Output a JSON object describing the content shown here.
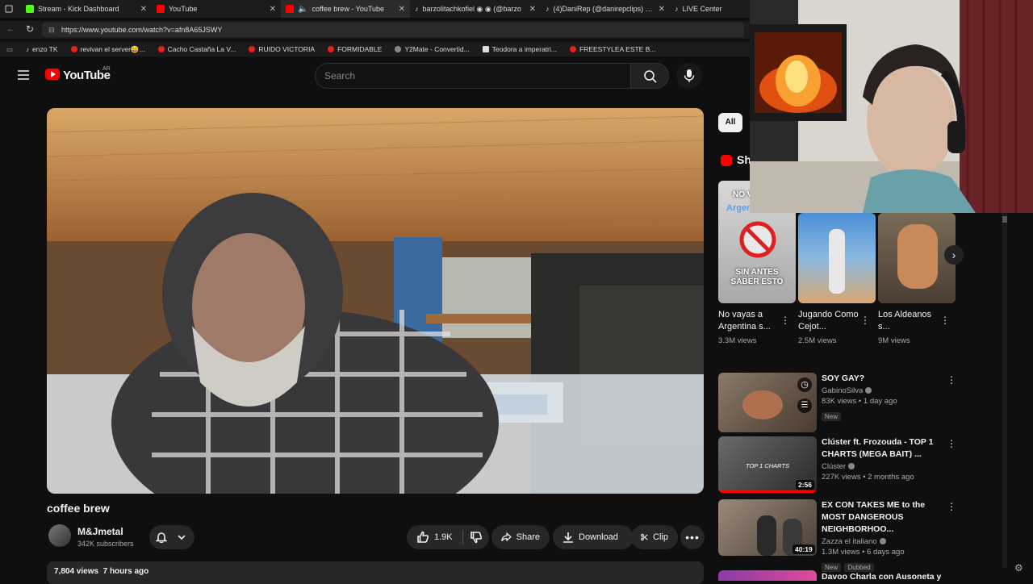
{
  "browser": {
    "tabs": [
      {
        "label": "Stream - Kick Dashboard",
        "color": "#53fc18"
      },
      {
        "label": "YouTube",
        "color": "#ff0000"
      },
      {
        "label": "coffee brew - YouTube",
        "color": "#ff0000"
      },
      {
        "label": "barzolitachkofiel ◉ ◉ (@barzo",
        "color": "#222"
      },
      {
        "label": "(4)DaniRep (@danirepclips) | TikT",
        "color": "#222"
      },
      {
        "label": "LIVE Center",
        "color": "#222"
      }
    ],
    "url": "https://www.youtube.com/watch?v=afn8A65JSWY",
    "bookmarks": [
      "enzo TK",
      "revivan el server😄...",
      "Cacho Castaña La V...",
      "RUIDO VICTORIA",
      "FORMIDABLE",
      "Y2Mate - Convertid...",
      "Teodora a imperatri...",
      "FREESTYLEA ESTE B..."
    ]
  },
  "header": {
    "logo_text": "YouTube",
    "country": "AR",
    "search_placeholder": "Search"
  },
  "video": {
    "title": "coffee brew",
    "channel": "M&Jmetal",
    "subscribers": "342K subscribers",
    "likes": "1.9K",
    "share_label": "Share",
    "download_label": "Download",
    "clip_label": "Clip",
    "views_date": "7,804 views  7 hours ago"
  },
  "sidebar": {
    "chip_all": "All",
    "shorts_heading": "Sh",
    "shorts": [
      {
        "title": "No vayas a Argentina s...",
        "views": "3.3M views",
        "thumb_text_top": "NO V",
        "thumb_text_mid": "Argentina",
        "thumb_text_bottom": "SIN ANTES SABER ESTO"
      },
      {
        "title": "Jugando Como Cejot...",
        "views": "2.5M views"
      },
      {
        "title": "Los Aldeanos s...",
        "views": "9M views"
      }
    ],
    "videos": [
      {
        "title": "SOY GAY?",
        "channel": "GabinoSilva",
        "meta": "83K views • 1 day ago",
        "badge": "New",
        "duration": ""
      },
      {
        "title": "Clúster ft. Frozouda - TOP 1 CHARTS (MEGA BAIT) ...",
        "channel": "Clúster",
        "meta": "227K views • 2 months ago",
        "badge": "",
        "duration": "2:56",
        "thumb_text": "TOP 1 CHARTS"
      },
      {
        "title": "EX CON TAKES ME to the MOST DANGEROUS NEIGHBORHOO...",
        "channel": "Zazza el italiano",
        "meta": "1.3M views • 6 days ago",
        "badge": "New",
        "badge2": "Dubbed",
        "duration": "40:19"
      },
      {
        "title": "Davoo Charla con Ausoneta y",
        "channel": "",
        "meta": "",
        "badge": "",
        "duration": ""
      }
    ]
  }
}
